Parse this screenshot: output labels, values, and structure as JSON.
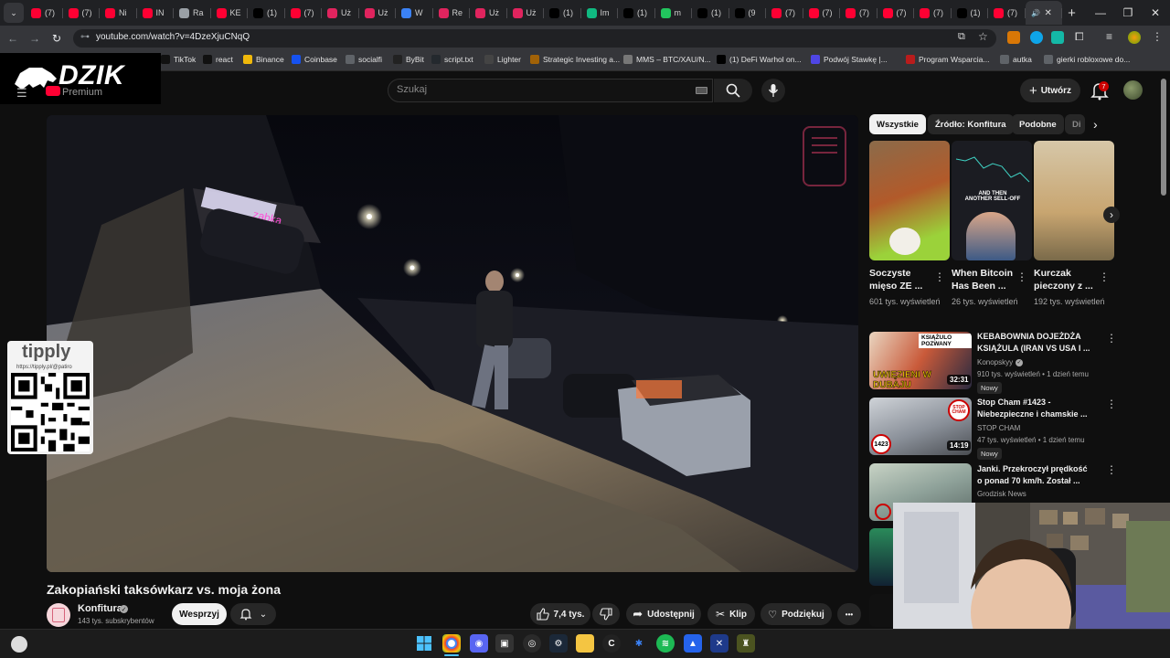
{
  "browser": {
    "tabs": [
      {
        "label": "(7)",
        "icon": "youtube",
        "color": "#ff0033"
      },
      {
        "label": "(7)",
        "icon": "youtube",
        "color": "#ff0033"
      },
      {
        "label": "Ni",
        "icon": "youtube",
        "color": "#ff0033"
      },
      {
        "label": "IN",
        "icon": "youtube",
        "color": "#ff0033"
      },
      {
        "label": "Ra",
        "icon": "globe",
        "color": "#9aa0a6"
      },
      {
        "label": "KE",
        "icon": "youtube",
        "color": "#ff0033"
      },
      {
        "label": "(1)",
        "icon": "x",
        "color": "#000000"
      },
      {
        "label": "(7)",
        "icon": "youtube",
        "color": "#ff0033"
      },
      {
        "label": "Uż",
        "icon": "arc",
        "color": "#e0245e"
      },
      {
        "label": "Uż",
        "icon": "arc",
        "color": "#e0245e"
      },
      {
        "label": "W",
        "icon": "web",
        "color": "#3b82f6"
      },
      {
        "label": "Re",
        "icon": "arc",
        "color": "#e0245e"
      },
      {
        "label": "Uż",
        "icon": "arc",
        "color": "#e0245e"
      },
      {
        "label": "Uż",
        "icon": "arc",
        "color": "#e0245e"
      },
      {
        "label": "(1)",
        "icon": "x",
        "color": "#000000"
      },
      {
        "label": "Im",
        "icon": "img",
        "color": "#10b981"
      },
      {
        "label": "(1)",
        "icon": "x",
        "color": "#000000"
      },
      {
        "label": "m",
        "icon": "k",
        "color": "#22c55e"
      },
      {
        "label": "(1)",
        "icon": "x",
        "color": "#000000"
      },
      {
        "label": "(9",
        "icon": "tiktok",
        "color": "#000000"
      },
      {
        "label": "(7)",
        "icon": "youtube",
        "color": "#ff0033"
      },
      {
        "label": "(7)",
        "icon": "youtube",
        "color": "#ff0033"
      },
      {
        "label": "(7)",
        "icon": "youtube",
        "color": "#ff0033"
      },
      {
        "label": "(7)",
        "icon": "youtube",
        "color": "#ff0033"
      },
      {
        "label": "(7)",
        "icon": "youtube",
        "color": "#ff0033"
      },
      {
        "label": "(1)",
        "icon": "x",
        "color": "#000000"
      },
      {
        "label": "(7)",
        "icon": "youtube",
        "color": "#ff0033"
      }
    ],
    "new_tab": "+",
    "url": "youtube.com/watch?v=4DzeXjuCNqQ",
    "bookmarks": [
      {
        "label": "TikTok",
        "color": "#111111"
      },
      {
        "label": "react",
        "color": "#111111"
      },
      {
        "label": "Binance",
        "color": "#f0b90b"
      },
      {
        "label": "Coinbase",
        "color": "#1652f0"
      },
      {
        "label": "socialfi",
        "color": "#5f6368"
      },
      {
        "label": "ByBit",
        "color": "#222222"
      },
      {
        "label": "script.txt",
        "color": "#24292e"
      },
      {
        "label": "Lighter",
        "color": "#444444"
      },
      {
        "label": "Strategic Investing a...",
        "color": "#a16207"
      },
      {
        "label": "MMS – BTC/XAU/N...",
        "color": "#777777"
      },
      {
        "label": "(1) DeFi Warhol on...",
        "color": "#000000"
      },
      {
        "label": "Podwój Stawkę |...",
        "color": "#4f46e5"
      },
      {
        "label": "Program Wsparcia...",
        "color": "#b91c1c"
      },
      {
        "label": "autka",
        "color": "#5f6368"
      },
      {
        "label": "gierki robloxowe do...",
        "color": "#5f6368"
      }
    ]
  },
  "youtube": {
    "logo_overlay": "DZIK",
    "logo_sub": "Premium",
    "search_placeholder": "Szukaj",
    "create_label": "Utwórz",
    "notifications": "7"
  },
  "video": {
    "title": "Zakopiański taksówkarz vs. moja żona",
    "channel": "Konfitura",
    "subscribers": "143 tys. subskrybentów",
    "support_label": "Wesprzyj",
    "likes": "7,4 tys.",
    "share_label": "Udostępnij",
    "clip_label": "Klip",
    "thanks_label": "Podziękuj",
    "more": "•••",
    "tipply": {
      "logo": "tipply",
      "url": "https://tipply.pl/@patiro"
    }
  },
  "chips": [
    "Wszystkie",
    "Źródło: Konfitura",
    "Podobne",
    "Di"
  ],
  "shorts": [
    {
      "title": "Soczyste mięso ZE ...",
      "views": "601 tys. wyświetleń"
    },
    {
      "title": "When Bitcoin Has Been ...",
      "views": "26 tys. wyświetleń",
      "thumb_caption": "AND THEN ANOTHER SELL-OFF"
    },
    {
      "title": "Kurczak pieczony z ...",
      "views": "192 tys. wyświetleń"
    }
  ],
  "recommended": [
    {
      "title": "KEBABOWNIA DOJEŻDŻA KSIĄŻULA (IRAN VS USA I ...",
      "channel": "Konopskyy",
      "verified": true,
      "meta": "910 tys. wyświetleń • 1 dzień temu",
      "badge": "Nowy",
      "duration": "32:31",
      "thumb_caption": "UWIĘZIENI W DUBAJU",
      "thumb_tag": "KSIĄŻULO POZWANY"
    },
    {
      "title": "Stop Cham #1423 - Niebezpieczne i chamskie ...",
      "channel": "STOP CHAM",
      "verified": false,
      "meta": "47 tys. wyświetleń • 1 dzień temu",
      "badge": "Nowy",
      "duration": "14:19",
      "thumb_caption": "1423",
      "thumb_tag": "STOP CHAM"
    },
    {
      "title": "Janki. Przekroczył prędkość o ponad 70 km/h. Został ...",
      "channel": "Grodzisk News",
      "verified": false,
      "meta": "",
      "badge": "",
      "duration": "",
      "thumb_caption": "",
      "thumb_tag": ""
    }
  ],
  "taskbar": [
    "start",
    "search",
    "chrome",
    "discord",
    "app",
    "obs",
    "steam",
    "explorer",
    "cursor",
    "python",
    "spotify",
    "app2",
    "capcut",
    "game"
  ]
}
